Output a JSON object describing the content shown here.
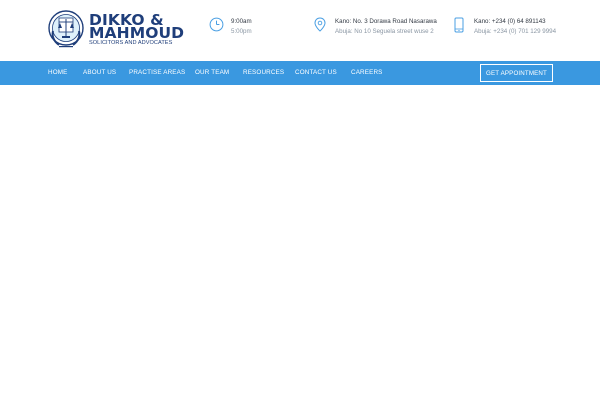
{
  "brand": {
    "name_line1": "DIKKO &",
    "name_line2": "MAHMOUD",
    "tagline": "SOLICITORS AND ADVOCATES"
  },
  "info": {
    "hours": {
      "icon": "clock-icon",
      "open": "9:00am",
      "close": "5:00pm"
    },
    "address": {
      "icon": "location-pin-icon",
      "kano": "Kano: No. 3 Dorawa Road Nasarawa",
      "abuja": "Abuja: No 10 Seguela street wuse 2"
    },
    "phone": {
      "icon": "mobile-phone-icon",
      "kano": "Kano: +234 (0) 64 891143",
      "abuja": "Abuja: +234 (0) 701 129 9994"
    }
  },
  "nav": {
    "items": [
      "HOME",
      "ABOUT US",
      "PRACTISE AREAS",
      "OUR TEAM",
      "RESOURCES",
      "CONTACT US",
      "CAREERS"
    ],
    "cta": "GET APPOINTMENT"
  },
  "colors": {
    "nav_bg": "#3a98e0",
    "brand_navy": "#1f3e7a",
    "icon_blue": "#4a9fe3"
  }
}
